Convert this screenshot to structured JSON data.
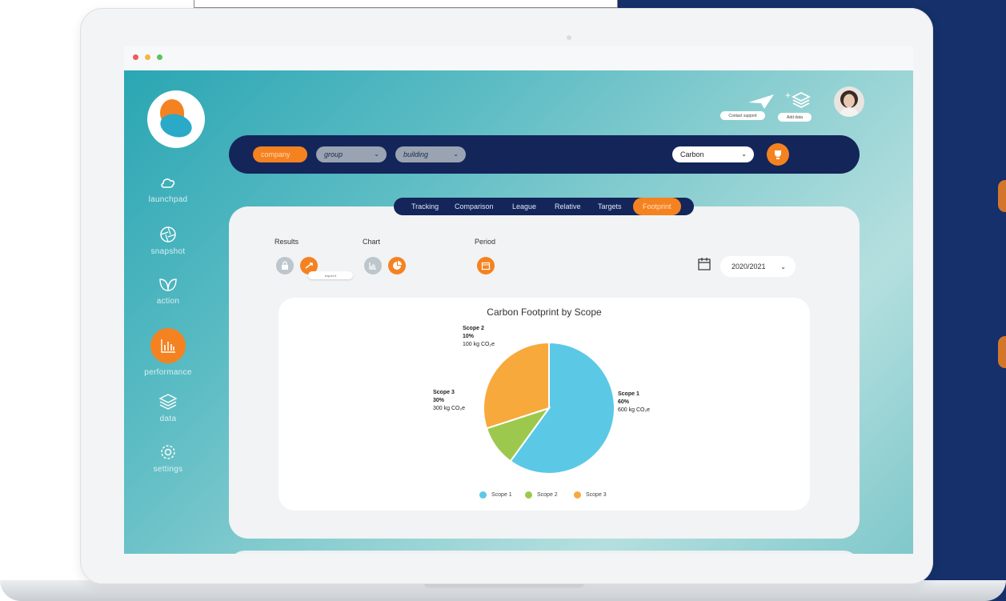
{
  "colors": {
    "accent": "#f58220",
    "navy": "#14255a",
    "teal": "#5bc0c8",
    "scope1": "#5bc8e6",
    "scope2": "#9cc94d",
    "scope3": "#f8a93c"
  },
  "sidebar": {
    "items": [
      {
        "label": "launchpad",
        "icon": "cloud-icon"
      },
      {
        "label": "snapshot",
        "icon": "aperture-icon"
      },
      {
        "label": "action",
        "icon": "leaf-icon"
      },
      {
        "label": "performance",
        "icon": "bar-chart-icon"
      },
      {
        "label": "data",
        "icon": "layers-icon"
      },
      {
        "label": "settings",
        "icon": "gear-icon"
      }
    ]
  },
  "header": {
    "contact_label": "Contact support",
    "add_label": "Add data"
  },
  "filters": {
    "company": "company",
    "group": "group",
    "building": "building",
    "metric": "Carbon"
  },
  "tabs": [
    "Tracking",
    "Comparison",
    "League",
    "Relative",
    "Targets",
    "Footprint"
  ],
  "controls": {
    "results_label": "Results",
    "chart_label": "Chart",
    "period_label": "Period",
    "export_tooltip": "export it",
    "period_value": "2020/2021"
  },
  "chart_data": {
    "type": "pie",
    "title": "Carbon Footprint by Scope",
    "slices": [
      {
        "name": "Scope 1",
        "percent": "60%",
        "value": 600,
        "value_label": "600 kg CO₂e",
        "color": "#5bc8e6"
      },
      {
        "name": "Scope 2",
        "percent": "10%",
        "value": 100,
        "value_label": "100 kg CO₂e",
        "color": "#9cc94d"
      },
      {
        "name": "Scope 3",
        "percent": "30%",
        "value": 300,
        "value_label": "300 kg CO₂e",
        "color": "#f8a93c"
      }
    ],
    "legend": [
      "Scope 1",
      "Scope 2",
      "Scope 3"
    ],
    "legend_position": "bottom"
  }
}
